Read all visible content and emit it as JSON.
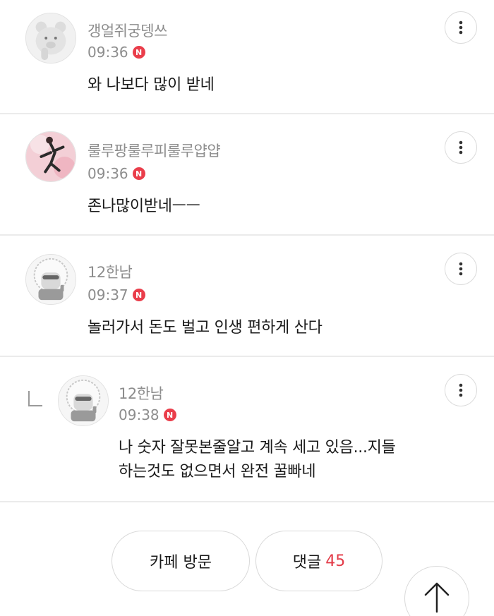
{
  "comments": [
    {
      "author": "갱얼쥐궁뎅쓰",
      "time": "09:36",
      "new_badge": "N",
      "text": "와 나보다 많이 받네"
    },
    {
      "author": "룰루팡룰루피룰루얍얍",
      "time": "09:36",
      "new_badge": "N",
      "text": "존나많이받네ㅡㅡ"
    },
    {
      "author": "12한남",
      "time": "09:37",
      "new_badge": "N",
      "text": "놀러가서 돈도 벌고 인생 편하게 산다"
    },
    {
      "author": "12한남",
      "time": "09:38",
      "new_badge": "N",
      "text_line1": "나 숫자 잘못본줄알고 계속 세고 있음...지들",
      "text_line2": "하는것도 없으면서 완전 꿀빠네"
    }
  ],
  "footer": {
    "cafe_visit_label": "카페 방문",
    "comments_label": "댓글",
    "comments_count": "45"
  },
  "icons": {
    "more": "more-vertical-icon",
    "reply": "reply-arrow-icon",
    "scroll_top": "arrow-up-icon"
  },
  "colors": {
    "badge": "#ea3e4b",
    "count": "#e33b48",
    "meta": "#8d8d8d"
  }
}
